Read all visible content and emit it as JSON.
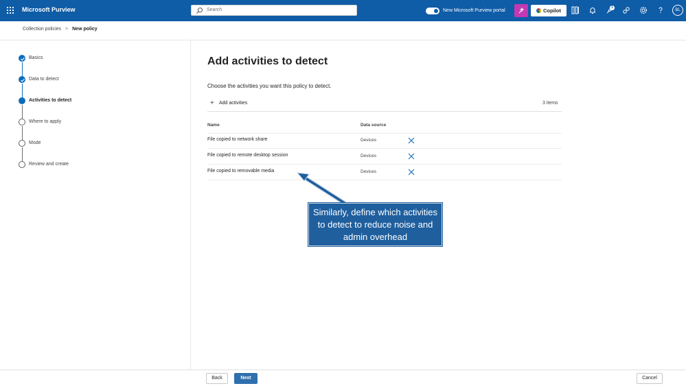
{
  "topbar": {
    "app_title": "Microsoft Purview",
    "search_placeholder": "Search",
    "toggle_label": "New Microsoft Purview portal",
    "copilot_label": "Copilot",
    "notification_count": "1",
    "avatar_initials": "BL",
    "brand_color": "#0f5ca7"
  },
  "breadcrumb": {
    "parent": "Collection policies",
    "separator": ">",
    "current": "New policy"
  },
  "steps": [
    {
      "label": "Basics",
      "state": "completed"
    },
    {
      "label": "Data to detect",
      "state": "completed"
    },
    {
      "label": "Activities to detect",
      "state": "current"
    },
    {
      "label": "Where to apply",
      "state": "pending"
    },
    {
      "label": "Mode",
      "state": "pending"
    },
    {
      "label": "Review and create",
      "state": "pending"
    }
  ],
  "main": {
    "heading": "Add activities to detect",
    "subtitle": "Choose the activities you want this policy to detect.",
    "add_label": "Add activities",
    "items_count": "3 items",
    "columns": {
      "name": "Name",
      "source": "Data source"
    },
    "rows": [
      {
        "name": "File copied to network share",
        "source": "Devices"
      },
      {
        "name": "File copied to remote desktop session",
        "source": "Devices"
      },
      {
        "name": "File copied to removable media",
        "source": "Devices"
      }
    ]
  },
  "callout": {
    "text": "Similarly, define which activities to detect to reduce noise and admin overhead"
  },
  "footer": {
    "back_label": "Back",
    "next_label": "Next",
    "cancel_label": "Cancel"
  },
  "icons": [
    "waffle-icon",
    "search-icon",
    "magic-icon",
    "copilot-icon",
    "apps-icon",
    "bell-icon",
    "rocket-icon",
    "link-icon",
    "gear-icon",
    "help-icon",
    "plus-icon",
    "close-icon",
    "checkmark-icon"
  ]
}
